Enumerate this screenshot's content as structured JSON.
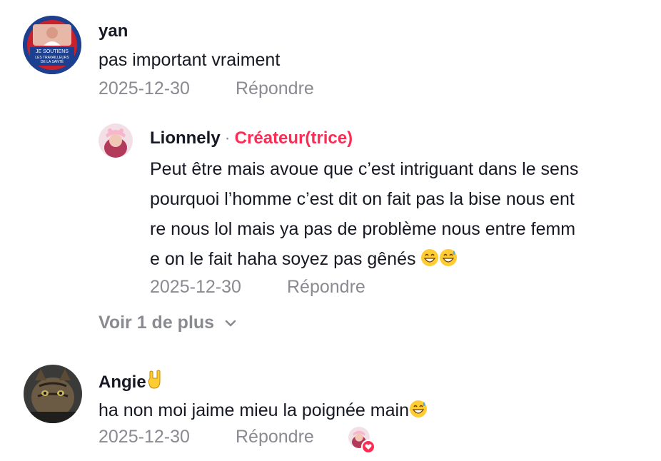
{
  "comments": [
    {
      "username": "yan",
      "text": "pas important vraiment",
      "date": "2025-12-30",
      "reply_label": "Répondre",
      "avatar_text": [
        "JE SOUTIENS",
        "LES TRAVAILLEURS",
        "DE LA SANTÉ"
      ],
      "replies": [
        {
          "username": "Lionnely",
          "badge": "Créateur(trice)",
          "lines": [
            "Peut être mais avoue que c’est intriguant dans le sens",
            "pourquoi l’homme c’est dit on fait pas la bise nous ent",
            "re nous lol mais ya pas de problème nous entre femm",
            "e on le fait haha soyez pas gênés"
          ],
          "date": "2025-12-30",
          "reply_label": "Répondre"
        }
      ],
      "more_label": "Voir 1 de plus"
    },
    {
      "username": "Angie",
      "text": "ha non moi jaime mieu la poignée main",
      "date": "2025-12-30",
      "reply_label": "Répondre",
      "liked_by_creator": true
    }
  ],
  "colors": {
    "accent": "#fe2c55",
    "muted": "#8a8b91",
    "text": "#161823"
  },
  "icons": {
    "chevron": "chevron-down-icon",
    "heart": "heart-icon"
  }
}
